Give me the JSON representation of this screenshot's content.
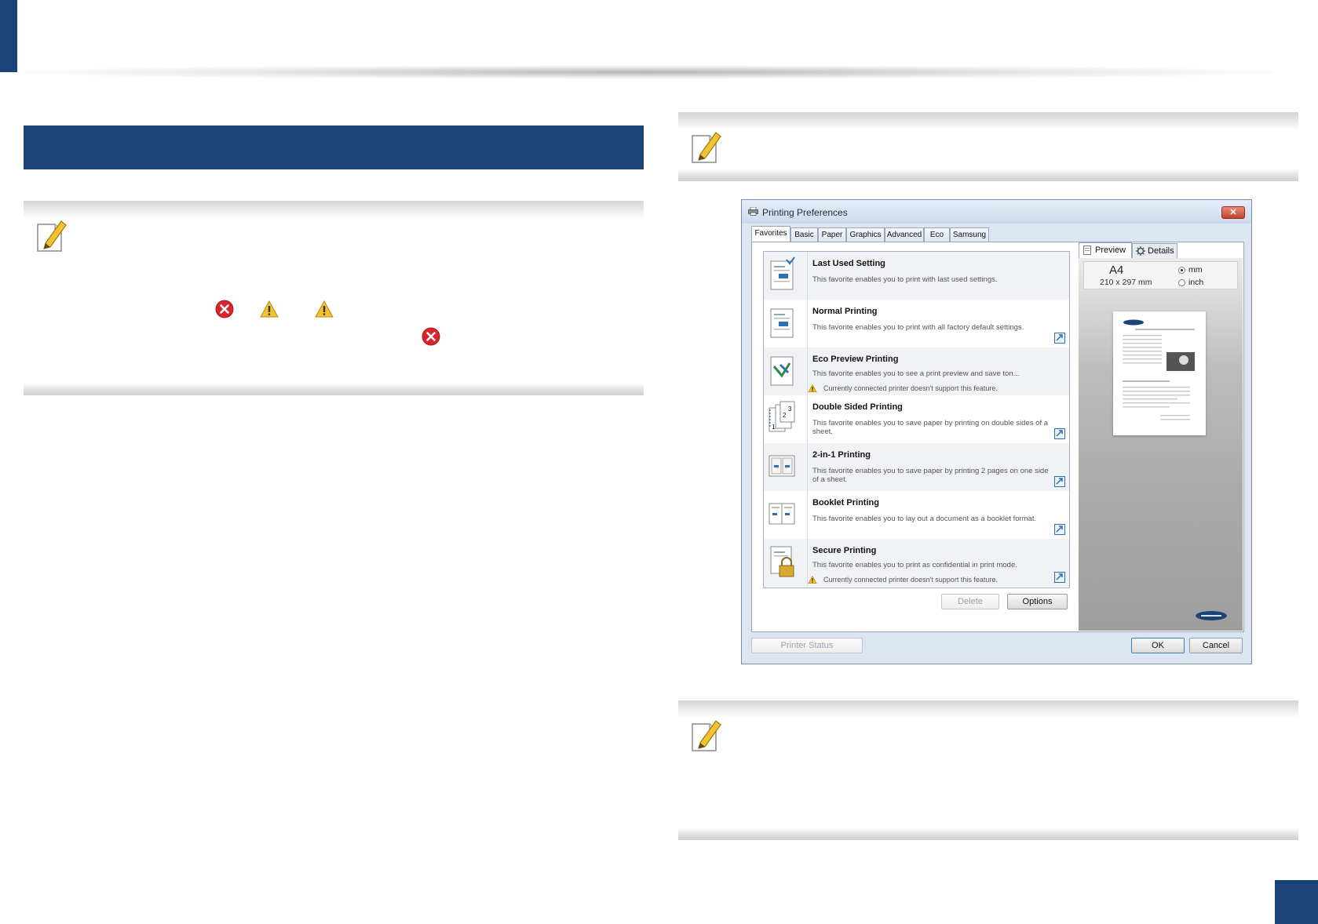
{
  "dialog": {
    "title": "Printing Preferences",
    "close_label": "✕",
    "tabs": [
      {
        "label": "Favorites",
        "active": true
      },
      {
        "label": "Basic"
      },
      {
        "label": "Paper"
      },
      {
        "label": "Graphics"
      },
      {
        "label": "Advanced"
      },
      {
        "label": "Eco"
      },
      {
        "label": "Samsung"
      }
    ],
    "favorites": [
      {
        "title": "Last Used Setting",
        "desc": "This favorite enables you to print with last used settings."
      },
      {
        "title": "Normal Printing",
        "desc": "This favorite enables you to print with all factory default settings."
      },
      {
        "title": "Eco Preview Printing",
        "desc": "This favorite enables you to see a print preview and save ton...",
        "warning": "Currently connected printer doesn't support this feature."
      },
      {
        "title": "Double Sided Printing",
        "desc": "This favorite enables you to save paper by printing on double sides of a sheet."
      },
      {
        "title": "2-in-1 Printing",
        "desc": "This favorite enables you to save paper by printing 2 pages on one side of a sheet."
      },
      {
        "title": "Booklet Printing",
        "desc": "This favorite enables you to lay out a document as a booklet format."
      },
      {
        "title": "Secure Printing",
        "desc": "This favorite enables you to print as confidential in print mode.",
        "warning": "Currently connected printer doesn't support this feature."
      }
    ],
    "delete_label": "Delete",
    "options_label": "Options",
    "preview": {
      "tab_preview": "Preview",
      "tab_details": "Details",
      "paper_size": "A4",
      "paper_dimensions": "210 x 297 mm",
      "unit_mm": "mm",
      "unit_inch": "inch",
      "selected_unit": "mm"
    },
    "printer_status_label": "Printer Status",
    "ok_label": "OK",
    "cancel_label": "Cancel"
  },
  "colors": {
    "brand_blue": "#1c4378",
    "error_red": "#d9262b",
    "warning_yellow": "#f2c230"
  },
  "icons": [
    "pencil-note-icon",
    "error-icon",
    "warning-icon",
    "printer-icon",
    "share-icon",
    "gear-icon"
  ]
}
